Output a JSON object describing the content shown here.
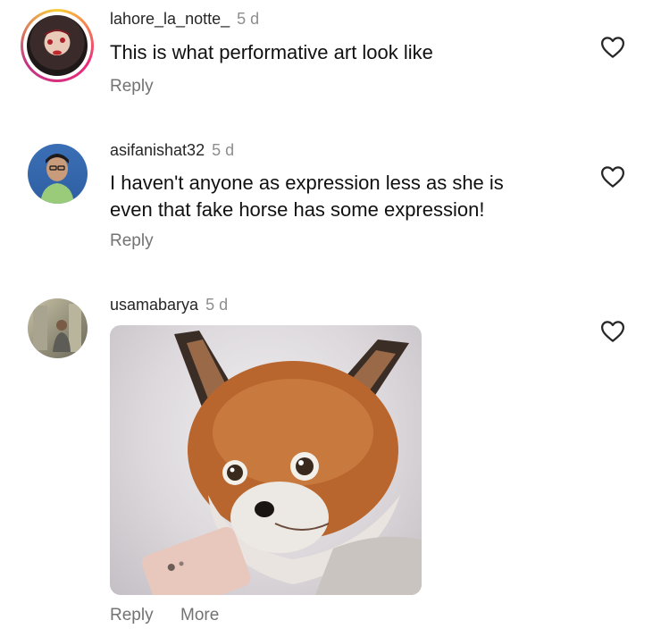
{
  "comments": [
    {
      "username": "lahore_la_notte_",
      "time": "5 d",
      "text": "This is what performative art look like",
      "reply_label": "Reply"
    },
    {
      "username": "asifanishat32",
      "time": "5 d",
      "text_lines": [
        "I haven't anyone as expression less as she is",
        "even that fake horse has some expression!"
      ],
      "reply_label": "Reply"
    },
    {
      "username": "usamabarya",
      "time": "5 d",
      "reply_label": "Reply",
      "more_label": "More"
    }
  ],
  "icons": {
    "like": "heart-outline-icon"
  },
  "colors": {
    "story_ring_start": "#f9ce34",
    "story_ring_mid": "#ee2a7b",
    "story_ring_end": "#c13584",
    "secondary_text": "#737373"
  }
}
